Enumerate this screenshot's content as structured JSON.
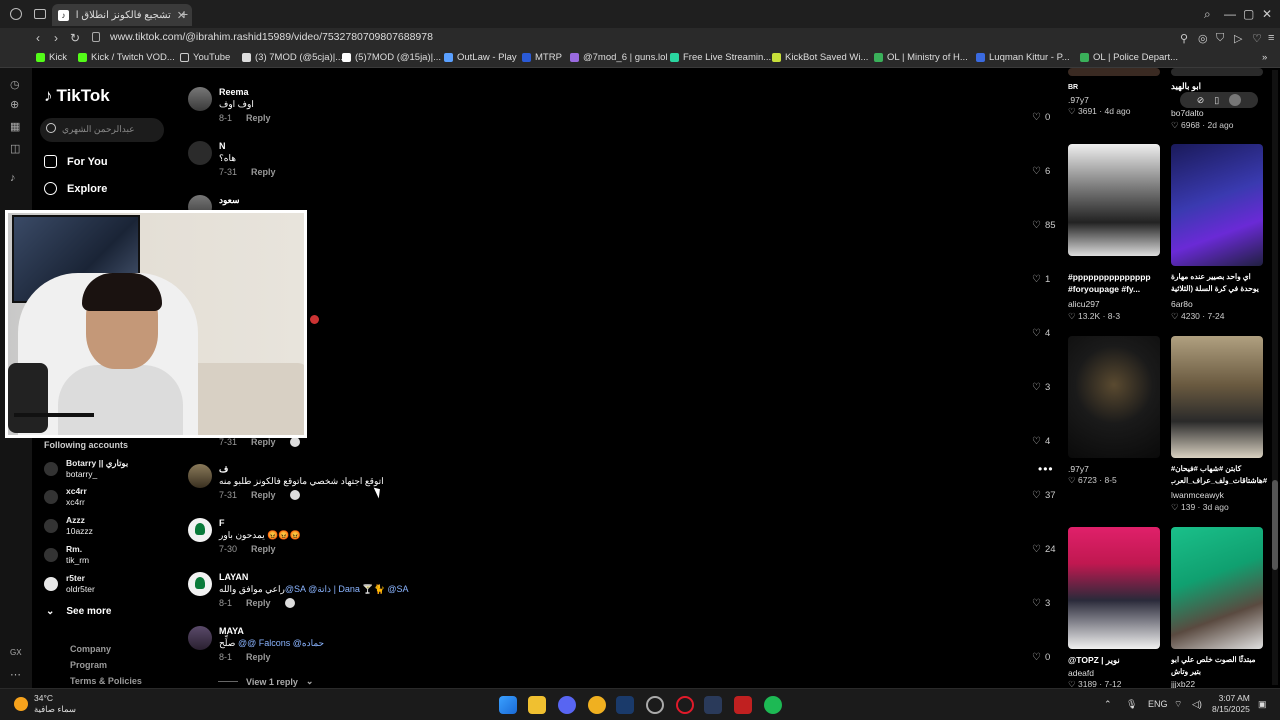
{
  "browser": {
    "tab_title": "تشجيع فالكونز انطلاق الموسـ...",
    "url": "www.tiktok.com/@ibrahim.rashid15989/video/7532780709807688978",
    "bookmarks": [
      "Kick",
      "Kick / Twitch VOD...",
      "YouTube",
      "(3) 7MOD (@5cja)|...",
      "(5)7MOD (@15ja)|...",
      "OutLaw - Play",
      "MTRP",
      "@7mod_6 | guns.lol",
      "Free Live Streamin...",
      "KickBot Saved Wi...",
      "OL | Ministry of H...",
      "Luqman Kittur - P...",
      "OL | Police Depart..."
    ]
  },
  "rail": {
    "label_gx": "GX"
  },
  "tiktok": {
    "logo": "TikTok",
    "search_placeholder": "عبدالرحمن الشهري",
    "nav": [
      "For You",
      "Explore"
    ],
    "following_header": "Following accounts",
    "accounts": [
      {
        "name": "Botarry || بوتاري",
        "handle": "botarry_"
      },
      {
        "name": "xc4rr",
        "handle": "xc4rr"
      },
      {
        "name": "Azzz",
        "handle": "10azzz"
      },
      {
        "name": "Rm.",
        "handle": "tik_rm"
      },
      {
        "name": "r5ter",
        "handle": "oldr5ter"
      }
    ],
    "see_more": "See more",
    "footer": [
      "Company",
      "Program",
      "Terms & Policies"
    ]
  },
  "comments": [
    {
      "user": "Reema",
      "text": "اوف اوف",
      "date": "8-1",
      "reply": "Reply",
      "likes": "0"
    },
    {
      "user": "N",
      "text": "هاه؟",
      "date": "7-31",
      "reply": "Reply",
      "likes": "6"
    },
    {
      "user": "سعود",
      "text": "",
      "date": "",
      "reply": "",
      "likes": "85"
    },
    {
      "user": "",
      "text": "",
      "date": "",
      "reply": "",
      "likes": "1"
    },
    {
      "user": "",
      "text": "",
      "date": "",
      "reply": "",
      "likes": "4"
    },
    {
      "user": "",
      "text": "",
      "date": "",
      "reply": "",
      "likes": "3"
    },
    {
      "user": "",
      "text": "",
      "date": "7-31",
      "reply": "Reply",
      "likes": "4"
    },
    {
      "user": "ف",
      "text": "اتوقع اجتهاد شخصي ماتوقع فالكونز طلبو منه",
      "date": "7-31",
      "reply": "Reply",
      "likes": "37"
    },
    {
      "user": "F",
      "text": "يمدحون باور 😡😡😡",
      "date": "7-30",
      "reply": "Reply",
      "likes": "24"
    },
    {
      "user": "LAYAN",
      "text_mention1": "@SA",
      "text_mid": "@ذاتة | Dana",
      "text_plain": "راعي موافق والله",
      "text_mention2": "@SA",
      "date": "8-1",
      "reply": "Reply",
      "likes": "3"
    },
    {
      "user": "MAYA",
      "text_mention": "@@ Falcons @حماده",
      "text_plain": "صلِّح",
      "date": "8-1",
      "reply": "Reply",
      "likes": "0"
    }
  ],
  "view_reply": "View 1 reply",
  "videos": [
    {
      "caption": "",
      "user": ".97y7",
      "likes": "3691",
      "date": "4d ago"
    },
    {
      "caption": "ابو بالهيد",
      "user": "bo7dalto",
      "likes": "6968",
      "date": "2d ago"
    },
    {
      "caption": "#ppppppppppppppp #foryoupage #fy...",
      "user": "alicu297",
      "likes": "13.2K",
      "date": "8-3"
    },
    {
      "caption": "اي واحد بصيير عنده مهارة يوحدة في كرة السلة (الثلاثية",
      "user": "6ar8o",
      "likes": "4230",
      "date": "7-24"
    },
    {
      "caption": "",
      "user": ".97y7",
      "likes": "6723",
      "date": "8-5"
    },
    {
      "caption": "كابتن #شهاب #فيحان# #هاشتاقات_ولف_عراف_العرب",
      "user": "lwanmceawyk",
      "likes": "139",
      "date": "3d ago"
    },
    {
      "caption": "@TOPZ | نوير",
      "user": "adeafd",
      "likes": "3189",
      "date": "7-12"
    },
    {
      "caption": "مبتدئًا الصوت خلص علي ابو بتير وتاش",
      "user": "jjjxb22",
      "likes": "",
      "date": ""
    }
  ],
  "taskbar": {
    "temp": "34°C",
    "weather": "سماء صافية",
    "lang": "ENG",
    "time": "3:07 AM",
    "date": "8/15/2025"
  }
}
